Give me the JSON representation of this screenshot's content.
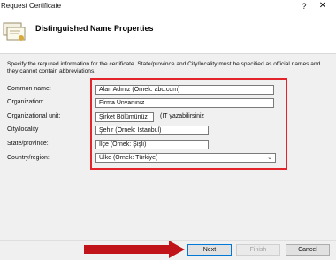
{
  "window": {
    "title": "Request Certificate",
    "help": "?",
    "close": "✕"
  },
  "header": {
    "title": "Distinguished Name Properties"
  },
  "instructions": "Specify the required information for the certificate. State/province and City/locality must be specified as official names and they cannot contain abbreviations.",
  "form": {
    "common_name": {
      "label": "Common name:",
      "value": "Alan Adınız (Örnek: abc.com)"
    },
    "organization": {
      "label": "Organization:",
      "value": "Firma Ünvanınız"
    },
    "org_unit": {
      "label": "Organizational unit:",
      "value": "Şirket Bölümünüz",
      "hint": "(IT yazabilirsiniz"
    },
    "city": {
      "label": "City/locality",
      "value": "Şehir (Örnek: İstanbul)"
    },
    "state": {
      "label": "State/province:",
      "value": "İlçe (Örnek: Şişli)"
    },
    "country": {
      "label": "Country/region:",
      "value": "Ülke (Örnek: Türkiye)"
    }
  },
  "buttons": {
    "next": "Next",
    "finish": "Finish",
    "cancel": "Cancel"
  },
  "colors": {
    "highlight": "#e3242b",
    "arrow": "#c0141a"
  }
}
